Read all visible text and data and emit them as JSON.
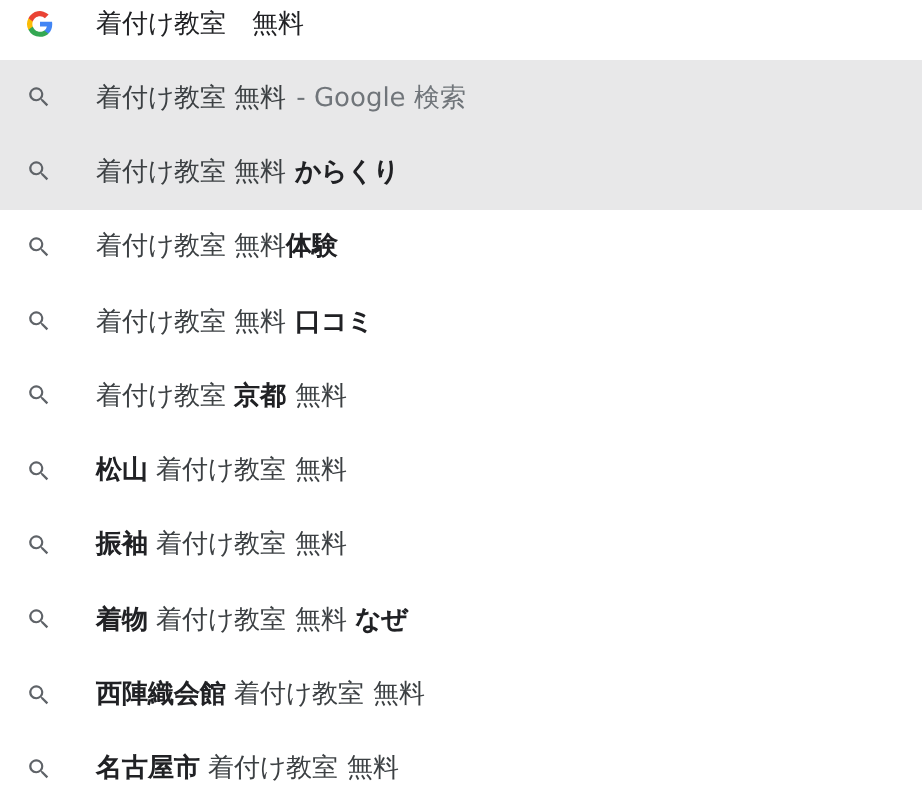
{
  "search": {
    "value": "着付け教室　無料"
  },
  "suggestions": [
    {
      "text": "着付け教室 無料",
      "suffix": "- Google 検索",
      "selected": true
    },
    {
      "text": "着付け教室 無料 **からくり**",
      "selected": true
    },
    {
      "text": "着付け教室 無料**体験**",
      "selected": false
    },
    {
      "text": "着付け教室 無料 **口コミ**",
      "selected": false
    },
    {
      "text": "着付け教室 **京都** 無料",
      "selected": false
    },
    {
      "text": "**松山** 着付け教室 無料",
      "selected": false
    },
    {
      "text": "**振袖** 着付け教室 無料",
      "selected": false
    },
    {
      "text": "**着物** 着付け教室 無料 **なぜ**",
      "selected": false
    },
    {
      "text": "**西陣織会館** 着付け教室 無料",
      "selected": false
    },
    {
      "text": "**名古屋市** 着付け教室 無料",
      "selected": false
    }
  ]
}
